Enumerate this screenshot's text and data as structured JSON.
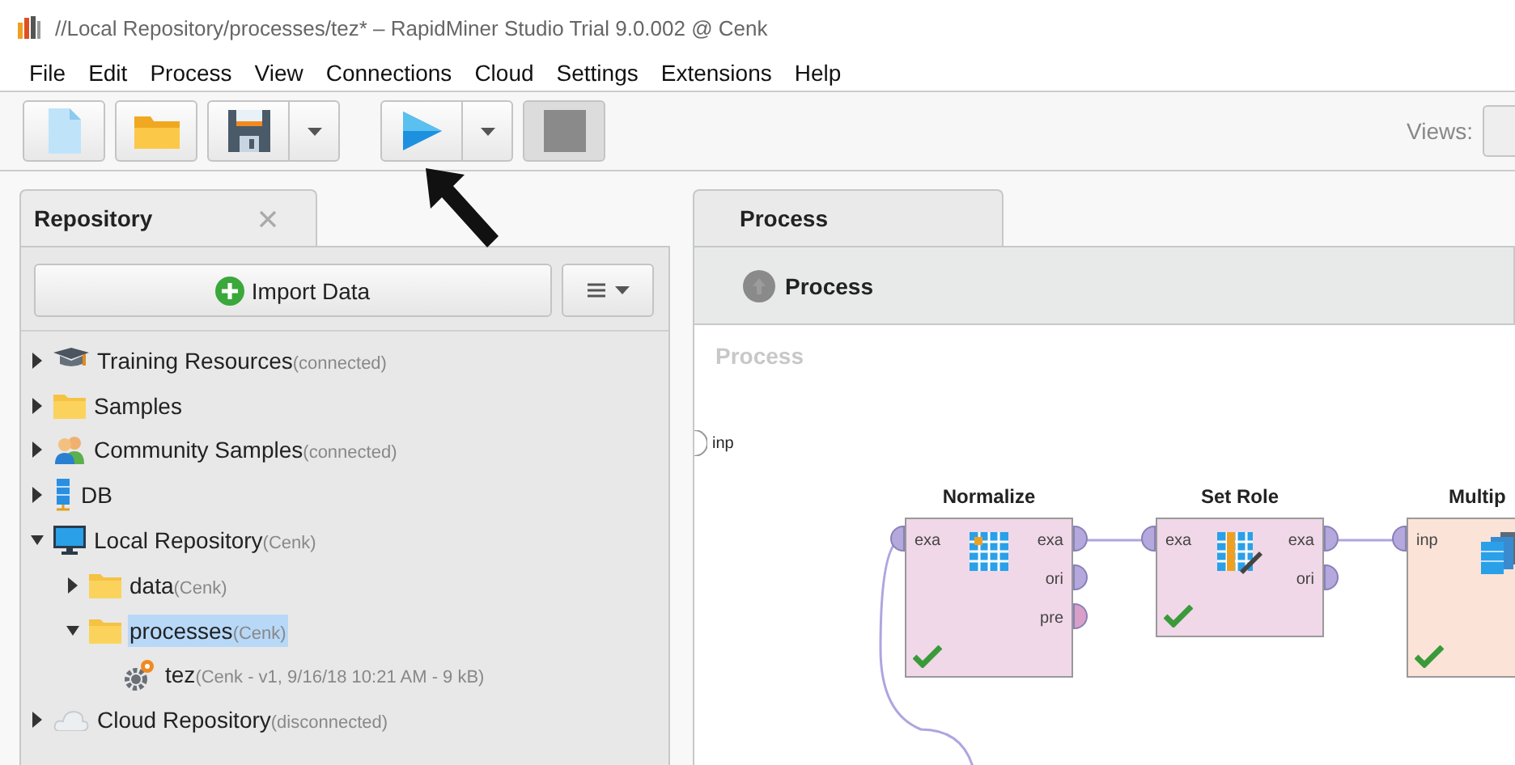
{
  "window": {
    "title": "//Local Repository/processes/tez* – RapidMiner Studio Trial 9.0.002 @ Cenk"
  },
  "menu": [
    "File",
    "Edit",
    "Process",
    "View",
    "Connections",
    "Cloud",
    "Settings",
    "Extensions",
    "Help"
  ],
  "toolbar": {
    "views_label": "Views:",
    "stop_disabled": true
  },
  "repository": {
    "tab": "Repository",
    "import_button": "Import Data",
    "tree": [
      {
        "kind": "training",
        "label": "Training Resources",
        "note": "(connected)",
        "expanded": false,
        "selected": false
      },
      {
        "kind": "folder",
        "label": "Samples",
        "expanded": false,
        "selected": false
      },
      {
        "kind": "community",
        "label": "Community Samples",
        "note": "(connected)",
        "expanded": false,
        "selected": false
      },
      {
        "kind": "database",
        "label": "DB",
        "expanded": false,
        "selected": false
      },
      {
        "kind": "local",
        "label": "Local Repository",
        "note": "(Cenk)",
        "expanded": true,
        "selected": false,
        "children": [
          {
            "kind": "folder",
            "label": "data",
            "note": "(Cenk)",
            "expanded": false,
            "selected": false
          },
          {
            "kind": "folder",
            "label": "processes",
            "note": "(Cenk)",
            "expanded": true,
            "selected": true,
            "children": [
              {
                "kind": "process",
                "label": "tez",
                "note": "(Cenk - v1, 9/16/18 10:21 AM - 9 kB)",
                "selected": false
              }
            ]
          }
        ]
      },
      {
        "kind": "cloud",
        "label": "Cloud Repository",
        "note": "(disconnected)",
        "expanded": false,
        "selected": false
      }
    ]
  },
  "process": {
    "tab": "Process",
    "breadcrumb": "Process",
    "canvas_label": "Process",
    "input_port": "inp",
    "operators": [
      {
        "name": "Normalize",
        "color": "#f0d8e8",
        "kind": "normalize",
        "inputs": [
          {
            "label": "exa",
            "color": "#b4a8dc"
          }
        ],
        "outputs": [
          {
            "label": "exa",
            "color": "#b4a8dc"
          },
          {
            "label": "ori",
            "color": "#b4a8dc"
          },
          {
            "label": "pre",
            "color": "#d8a0c8"
          }
        ]
      },
      {
        "name": "Set Role",
        "color": "#f0d8e8",
        "kind": "set-role",
        "inputs": [
          {
            "label": "exa",
            "color": "#b4a8dc"
          }
        ],
        "outputs": [
          {
            "label": "exa",
            "color": "#b4a8dc"
          },
          {
            "label": "ori",
            "color": "#b4a8dc"
          }
        ]
      },
      {
        "name": "Multip",
        "color": "#fbe3d8",
        "kind": "multiply",
        "inputs": [
          {
            "label": "inp",
            "color": "#b4a8dc"
          }
        ]
      }
    ]
  }
}
